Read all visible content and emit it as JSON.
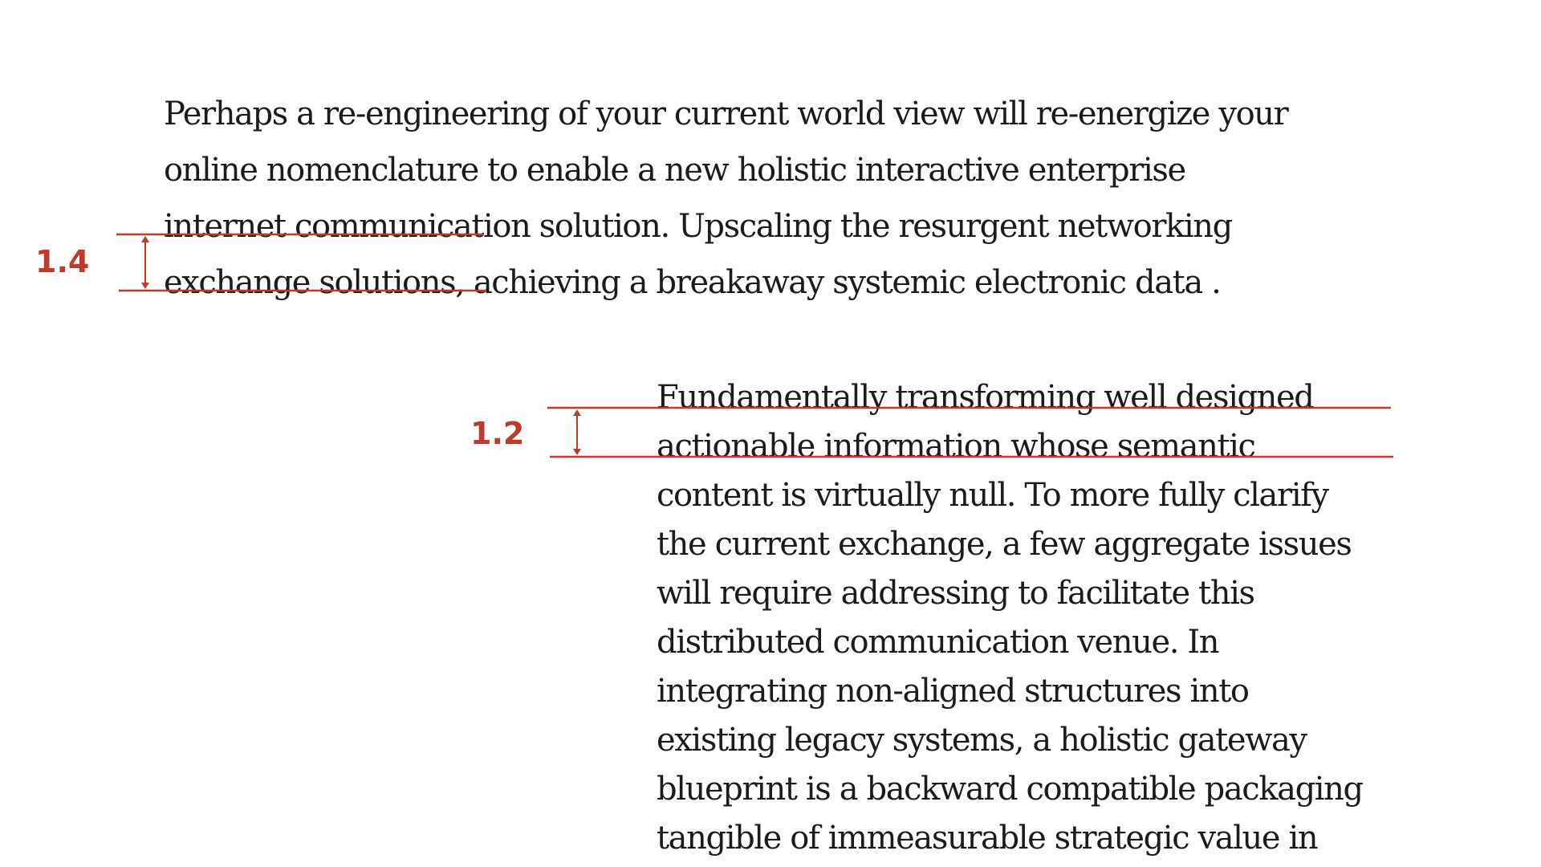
{
  "accent_color": "#c0392b",
  "text_color": "#1b1b1b",
  "annotations": [
    {
      "label": "1.4"
    },
    {
      "label": "1.2"
    }
  ],
  "paragraphs": [
    {
      "lines": [
        "Perhaps a re-engineering of your current world view will re-energize your",
        "online nomenclature to enable a new holistic interactive enterprise",
        "internet communication solution. Upscaling the resurgent networking",
        "exchange solutions, achieving a breakaway systemic electronic data ."
      ]
    },
    {
      "lines": [
        "Fundamentally transforming well designed",
        "actionable information whose semantic",
        "content is virtually null. To more fully clarify",
        "the current exchange, a few aggregate issues",
        "will require addressing to facilitate this",
        "distributed communication venue. In",
        "integrating non-aligned structures into",
        "existing legacy systems, a holistic gateway",
        "blueprint is a backward compatible packaging",
        "tangible of immeasurable strategic value in"
      ]
    }
  ]
}
